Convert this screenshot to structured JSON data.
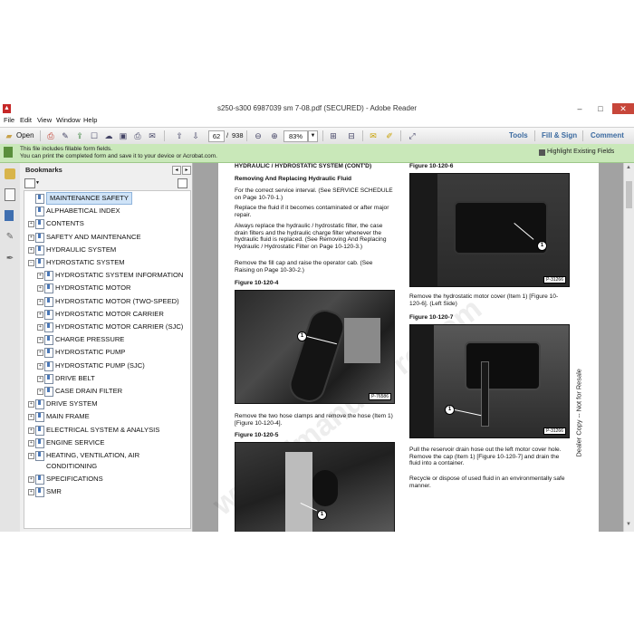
{
  "window": {
    "title": "s250-s300 6987039 sm 7-08.pdf (SECURED) - Adobe Reader",
    "controls": [
      "–",
      "□",
      "✕"
    ]
  },
  "menu": [
    "File",
    "Edit",
    "View",
    "Window",
    "Help"
  ],
  "toolbar": {
    "open_label": "Open",
    "page_current": "62",
    "page_separator": "/",
    "page_total": "938",
    "zoom": "83%",
    "tools_label": "Tools",
    "fill_sign_label": "Fill & Sign",
    "comment_label": "Comment"
  },
  "notice": {
    "line1": "This file includes fillable form fields.",
    "line2": "You can print the completed form and save it to your device or Acrobat.com.",
    "highlight_label": "Highlight Existing Fields"
  },
  "bookmarks": {
    "title": "Bookmarks",
    "items": [
      {
        "label": "MAINTENANCE SAFETY",
        "level": 0,
        "expander": "",
        "selected": true
      },
      {
        "label": "ALPHABETICAL INDEX",
        "level": 0,
        "expander": ""
      },
      {
        "label": "CONTENTS",
        "level": 0,
        "expander": "+"
      },
      {
        "label": "SAFETY AND MAINTENANCE",
        "level": 0,
        "expander": "+"
      },
      {
        "label": "HYDRAULIC SYSTEM",
        "level": 0,
        "expander": "+"
      },
      {
        "label": "HYDROSTATIC SYSTEM",
        "level": 0,
        "expander": "−"
      },
      {
        "label": "HYDROSTATIC SYSTEM INFORMATION",
        "level": 1,
        "expander": "+"
      },
      {
        "label": "HYDROSTATIC MOTOR",
        "level": 1,
        "expander": "+"
      },
      {
        "label": "HYDROSTATIC MOTOR (TWO-SPEED)",
        "level": 1,
        "expander": "+"
      },
      {
        "label": "HYDROSTATIC MOTOR CARRIER",
        "level": 1,
        "expander": "+"
      },
      {
        "label": "HYDROSTATIC MOTOR CARRIER (SJC)",
        "level": 1,
        "expander": "+"
      },
      {
        "label": "CHARGE PRESSURE",
        "level": 1,
        "expander": "+"
      },
      {
        "label": "HYDROSTATIC PUMP",
        "level": 1,
        "expander": "+"
      },
      {
        "label": "HYDROSTATIC PUMP (SJC)",
        "level": 1,
        "expander": "+"
      },
      {
        "label": "DRIVE BELT",
        "level": 1,
        "expander": "+"
      },
      {
        "label": "CASE DRAIN FILTER",
        "level": 1,
        "expander": "+"
      },
      {
        "label": "DRIVE SYSTEM",
        "level": 0,
        "expander": "+"
      },
      {
        "label": "MAIN FRAME",
        "level": 0,
        "expander": "+"
      },
      {
        "label": "ELECTRICAL SYSTEM & ANALYSIS",
        "level": 0,
        "expander": "+"
      },
      {
        "label": "ENGINE SERVICE",
        "level": 0,
        "expander": "+"
      },
      {
        "label": "HEATING, VENTILATION, AIR",
        "level": 0,
        "expander": "+",
        "label2": "CONDITIONING"
      },
      {
        "label": "SPECIFICATIONS",
        "level": 0,
        "expander": "+"
      },
      {
        "label": "SMR",
        "level": 0,
        "expander": "+"
      }
    ]
  },
  "document": {
    "header": "HYDRAULIC / HYDROSTATIC SYSTEM (CONT'D)",
    "section_title": "Removing And Replacing Hydraulic Fluid",
    "p1": "For the correct service interval. (See SERVICE SCHEDULE on Page 10-70-1.)",
    "p2": "Replace the fluid if it becomes contaminated or after major repair.",
    "p3": "Always replace the hydraulic / hydrostatic filter, the case drain filters and the hydraulic charge filter whenever the hydraulic fluid is replaced. (See Removing And Replacing Hydraulic / Hydrostatic Filter on Page 10-120-3.)",
    "p4": "Remove the fill cap and raise the operator cab. (See Raising on Page 10-30-2.)",
    "fig4_label": "Figure 10-120-4",
    "fig4_code": "P-76586",
    "p5": "Remove the two hose clamps and remove the hose (Item 1) [Figure 10-120-4].",
    "fig5_label": "Figure 10-120-5",
    "fig6_label": "Figure 10-120-6",
    "fig6_code": "P-31266",
    "p6": "Remove the hydrostatic motor cover (Item 1) [Figure 10-120-6]. (Left Side)",
    "fig7_label": "Figure 10-120-7",
    "fig7_code": "P-31266",
    "p7": "Pull the reservoir drain hose out the left motor cover hole. Remove the cap (Item 1) [Figure 10-120-7] and drain the fluid into a container.",
    "p8": "Recycle or dispose of used fluid in an environmentally safe manner.",
    "callout": "1",
    "side_note": "Dealer Copy -- Not for Resale"
  },
  "colors": {
    "notice_bg": "#c9e8b9",
    "close_button": "#c7463a",
    "link_blue": "#3b6aa0",
    "selection": "#cfe3f7"
  }
}
